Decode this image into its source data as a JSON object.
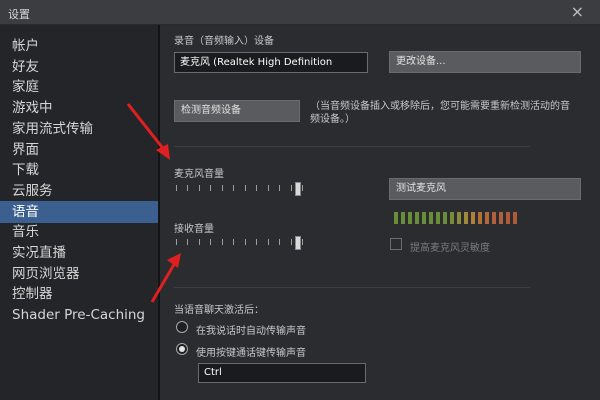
{
  "window": {
    "title": "设置"
  },
  "sidebar": {
    "items": [
      {
        "label": "帐户"
      },
      {
        "label": "好友"
      },
      {
        "label": "家庭"
      },
      {
        "label": "游戏中"
      },
      {
        "label": "家用流式传输"
      },
      {
        "label": "界面"
      },
      {
        "label": "下载"
      },
      {
        "label": "云服务"
      },
      {
        "label": "语音"
      },
      {
        "label": "音乐"
      },
      {
        "label": "实况直播"
      },
      {
        "label": "网页浏览器"
      },
      {
        "label": "控制器"
      },
      {
        "label": "Shader Pre-Caching"
      }
    ],
    "active_index": 8
  },
  "voice": {
    "recording_device_label": "录音（音频输入）设备",
    "recording_device_value": "麦克风 (Realtek High Definition",
    "change_device_button": "更改设备...",
    "redetect_button": "检测音频设备",
    "redetect_hint": "（当音频设备插入或移除后，您可能需要重新检测活动的音频设备。）",
    "mic_volume_label": "麦克风音量",
    "mic_volume_level": 0.93,
    "test_mic_button": "测试麦克风",
    "receive_volume_label": "接收音量",
    "receive_volume_level": 0.93,
    "boost_mic_label": "提高麦克风灵敏度",
    "boost_mic_checked": false,
    "meter_colors": [
      "#6a8d3a",
      "#6a8d3a",
      "#6a8d3a",
      "#6a8d3a",
      "#6a8d3a",
      "#6a8d3a",
      "#6a8d3a",
      "#6a8d3a",
      "#7a8a3a",
      "#8a8a3a",
      "#a08a3a",
      "#b0803a",
      "#b0703a",
      "#b06a3a",
      "#b0603a",
      "#b0603a",
      "#b05a3a",
      "#b05a3a"
    ],
    "activation_label": "当语音聊天激活后：",
    "activation_options": [
      {
        "label": "在我说话时自动传输声音",
        "selected": false
      },
      {
        "label": "使用按键通话键传输声音",
        "selected": true
      }
    ],
    "push_to_talk_key": "Ctrl"
  }
}
